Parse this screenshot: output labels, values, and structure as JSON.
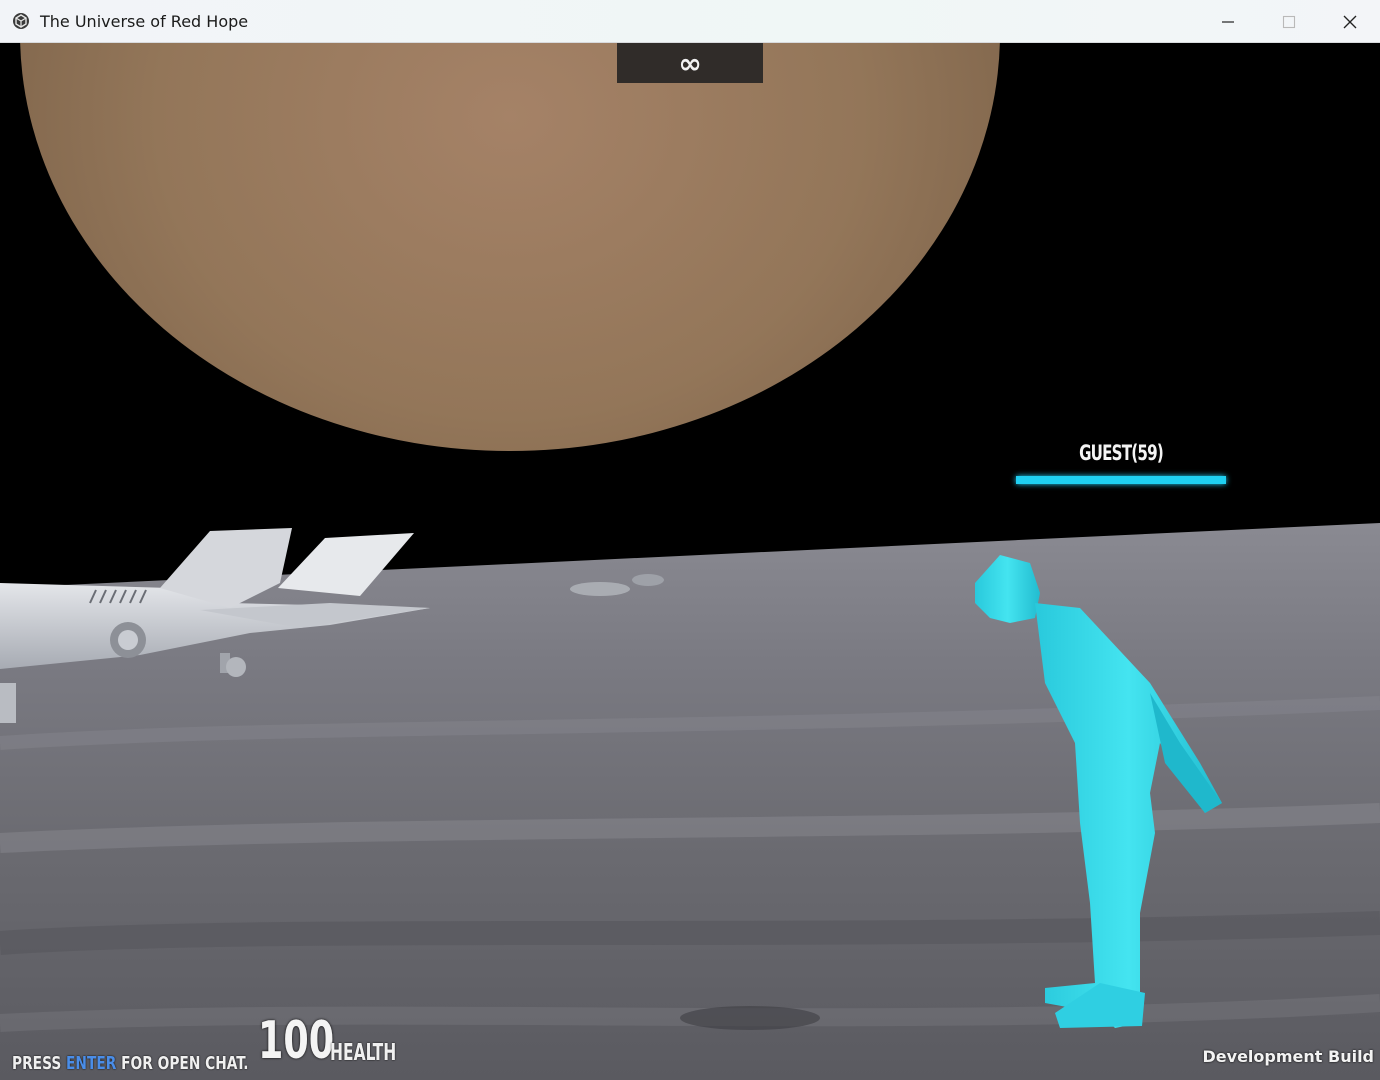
{
  "window": {
    "title": "The Universe of Red Hope",
    "app_icon": "unity-icon",
    "controls": {
      "minimize_icon": "minimize-icon",
      "maximize_icon": "maximize-icon",
      "close_icon": "close-icon"
    }
  },
  "hud": {
    "counter": "∞",
    "player_nameplate": {
      "name": "GUEST(59)",
      "health_fraction": 1.0,
      "bar_color": "#1fd0f2"
    },
    "chat_hint": {
      "prefix": "PRESS ",
      "key": "ENTER",
      "suffix": " FOR OPEN CHAT.",
      "key_color": "#4a8de8"
    },
    "health": {
      "value": "100",
      "label": "HEALTH"
    },
    "build_label": "Development Build"
  },
  "scene": {
    "sky_color": "#000000",
    "planet_color": "#9a7a5e",
    "ground_color": "#6e6e74",
    "avatar_color": "#2fd6e6",
    "objects": [
      "planet",
      "spaceship",
      "distant-vehicles",
      "player-avatar",
      "ground"
    ]
  }
}
